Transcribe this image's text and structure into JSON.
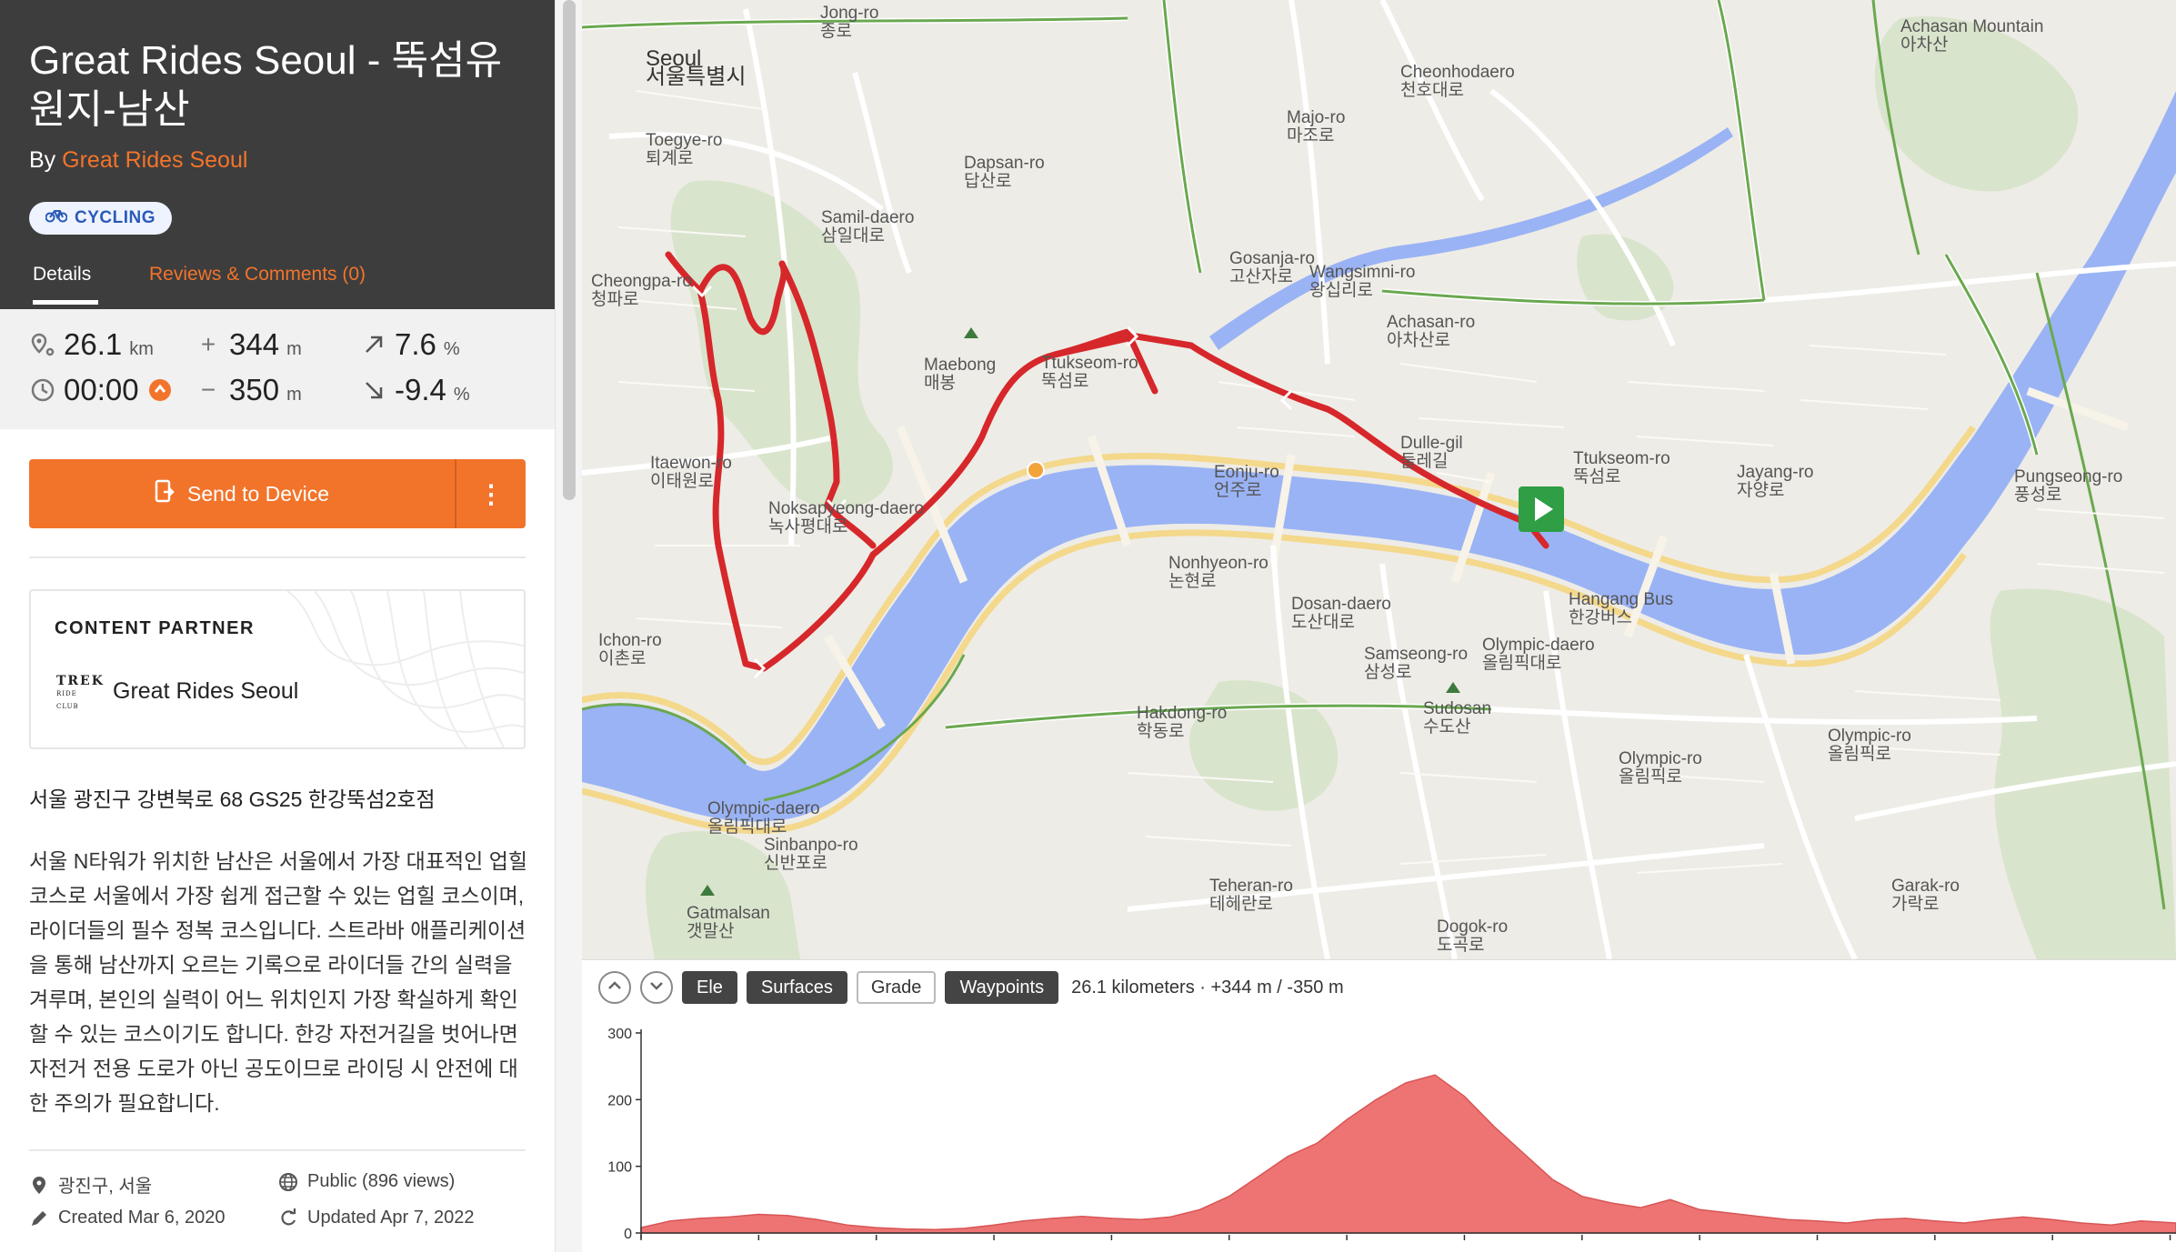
{
  "route": {
    "title": "Great Rides Seoul - 뚝섬유원지-남산",
    "by_prefix": "By",
    "author": "Great Rides Seoul",
    "activity": "CYCLING"
  },
  "tabs": {
    "details": "Details",
    "reviews": "Reviews & Comments (0)"
  },
  "stats": {
    "distance": {
      "value": "26.1",
      "unit": "km"
    },
    "elev_gain": {
      "value": "344",
      "unit": "m"
    },
    "grade_up": {
      "value": "7.6",
      "unit": "%"
    },
    "time": {
      "value": "00:00"
    },
    "elev_loss": {
      "value": "350",
      "unit": "m"
    },
    "grade_down": {
      "value": "-9.4",
      "unit": "%"
    }
  },
  "actions": {
    "send_to_device": "Send to Device"
  },
  "partner": {
    "heading": "CONTENT PARTNER",
    "name": "Great Rides Seoul",
    "logo_top": "TREK",
    "logo_bottom": "RIDE CLUB"
  },
  "address": "서울 광진구 강변북로 68 GS25 한강뚝섬2호점",
  "description": "서울 N타워가 위치한 남산은 서울에서 가장 대표적인 업힐 코스로 서울에서 가장 쉽게 접근할 수 있는 업힐 코스이며, 라이더들의 필수 정복 코스입니다. 스트라바 애플리케이션을 통해 남산까지 오르는 기록으로 라이더들 간의 실력을 겨루며, 본인의 실력이 어느 위치인지 가장 확실하게 확인할 수 있는 코스이기도 합니다. 한강 자전거길을 벗어나면 자전거 전용 도로가 아닌 공도이므로 라이딩 시 안전에 대한 주의가 필요합니다.",
  "meta": {
    "location": "광진구, 서울",
    "visibility": "Public (896 views)",
    "created": "Created Mar 6, 2020",
    "updated": "Updated Apr 7, 2022"
  },
  "map_labels": [
    {
      "en": "Seoul",
      "ko": "서울특별시",
      "big": true
    },
    {
      "en": "Jong-ro",
      "ko": "종로"
    },
    {
      "en": "Toegye-ro",
      "ko": "퇴계로"
    },
    {
      "en": "Samil-daero",
      "ko": "삼일대로"
    },
    {
      "en": "Cheongpa-ro",
      "ko": "청파로"
    },
    {
      "en": "Maebong",
      "ko": "매봉"
    },
    {
      "en": "Itaewon-ro",
      "ko": "이태원로"
    },
    {
      "en": "Noksapyeong-daero",
      "ko": "녹사평대로"
    },
    {
      "en": "Ichon-ro",
      "ko": "이촌로"
    },
    {
      "en": "Olympic-daero",
      "ko": "올림픽대로"
    },
    {
      "en": "Sinbanpo-ro",
      "ko": "신반포로"
    },
    {
      "en": "Gatmalsan",
      "ko": "갯말산"
    },
    {
      "en": "Ttukseom-ro",
      "ko": "뚝섬로"
    },
    {
      "en": "Gosanja-ro",
      "ko": "고산자로"
    },
    {
      "en": "Wangsimni-ro",
      "ko": "왕십리로"
    },
    {
      "en": "Achasan-ro",
      "ko": "아차산로"
    },
    {
      "en": "Dulle-gil",
      "ko": "둘레길"
    },
    {
      "en": "Eonju-ro",
      "ko": "언주로"
    },
    {
      "en": "Nonhyeon-ro",
      "ko": "논현로"
    },
    {
      "en": "Dosan-daero",
      "ko": "도산대로"
    },
    {
      "en": "Hakdong-ro",
      "ko": "학동로"
    },
    {
      "en": "Samseong-ro",
      "ko": "삼성로"
    },
    {
      "en": "Sudosan",
      "ko": "수도산"
    },
    {
      "en": "Olympic-daero",
      "ko": "올림픽대로"
    },
    {
      "en": "Hangang Bus",
      "ko": "한강버스"
    },
    {
      "en": "Olympic-ro",
      "ko": "올림픽로"
    },
    {
      "en": "Olympic-ro",
      "ko": "올림픽로"
    },
    {
      "en": "Teheran-ro",
      "ko": "테헤란로"
    },
    {
      "en": "Dogok-ro",
      "ko": "도곡로"
    },
    {
      "en": "Garak-ro",
      "ko": "가락로"
    },
    {
      "en": "Ttukseom-ro",
      "ko": "뚝섬로"
    },
    {
      "en": "Jayang-ro",
      "ko": "자양로"
    },
    {
      "en": "Achasan Mountain",
      "ko": "아차산"
    },
    {
      "en": "Pungseong-ro",
      "ko": "풍성로"
    },
    {
      "en": "Cheonhodaero",
      "ko": "천호대로"
    },
    {
      "en": "Majo-ro",
      "ko": "마조로"
    },
    {
      "en": "Dapsan-ro",
      "ko": "답산로"
    }
  ],
  "elevation": {
    "buttons": {
      "ele": "Ele",
      "surfaces": "Surfaces",
      "grade": "Grade",
      "waypoints": "Waypoints"
    },
    "summary": "26.1 kilometers · +344 m / -350 m"
  },
  "chart_data": {
    "type": "area",
    "title": "",
    "xlabel": "",
    "ylabel": "",
    "ylim": [
      0,
      300
    ],
    "y_ticks": [
      0,
      100,
      200,
      300
    ],
    "x_range_km": [
      0,
      26.1
    ],
    "x": [
      0,
      0.5,
      1,
      1.5,
      2,
      2.5,
      3,
      3.5,
      4,
      4.5,
      5,
      5.5,
      6,
      6.5,
      7,
      7.5,
      8,
      8.5,
      9,
      9.5,
      10,
      10.5,
      11,
      11.5,
      12,
      12.5,
      13,
      13.5,
      14,
      14.5,
      15,
      15.5,
      16,
      16.5,
      17,
      17.5,
      18,
      18.5,
      19,
      19.5,
      20,
      20.5,
      21,
      21.5,
      22,
      22.5,
      23,
      23.5,
      24,
      24.5,
      25,
      25.5,
      26.1
    ],
    "values": [
      8,
      18,
      22,
      24,
      28,
      26,
      20,
      12,
      8,
      6,
      5,
      7,
      12,
      18,
      22,
      25,
      22,
      20,
      24,
      35,
      55,
      85,
      115,
      135,
      170,
      200,
      225,
      237,
      205,
      160,
      120,
      80,
      55,
      45,
      38,
      50,
      35,
      30,
      25,
      20,
      18,
      15,
      20,
      22,
      18,
      15,
      20,
      24,
      20,
      15,
      12,
      18,
      15
    ],
    "color": "#e96868",
    "colors": {
      "accent": "#f2742b",
      "route": "#d6272b",
      "water": "#9ab3f5",
      "start": "#2f9e44",
      "elev_fill": "#ee7474"
    }
  }
}
